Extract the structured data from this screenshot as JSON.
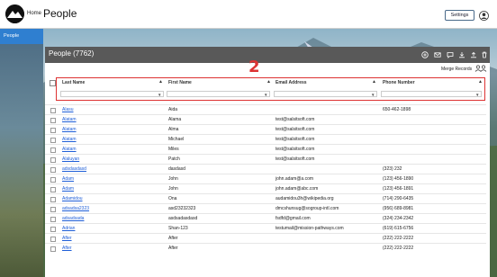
{
  "app": {
    "home_label": "Home",
    "title": "People",
    "settings_label": "Settings"
  },
  "sidebar": {
    "items": [
      {
        "label": "People"
      }
    ]
  },
  "panel": {
    "title": "People (7762)",
    "merge_label": "Merge Records",
    "annotation": "2"
  },
  "table": {
    "columns": [
      {
        "label": "Last Name"
      },
      {
        "label": "First Name"
      },
      {
        "label": "Email Address"
      },
      {
        "label": "Phone Number"
      }
    ],
    "rows": [
      {
        "last": "Alasu",
        "first": "Aida",
        "email": "",
        "phone": "650-462-1898"
      },
      {
        "last": "Alatam",
        "first": "Alama",
        "email": "test@salsitsoft.com",
        "phone": ""
      },
      {
        "last": "Alatam",
        "first": "Alma",
        "email": "test@salsitsoft.com",
        "phone": ""
      },
      {
        "last": "Alatam",
        "first": "Michael",
        "email": "test@salsitsoft.com",
        "phone": ""
      },
      {
        "last": "Alatam",
        "first": "Miles",
        "email": "test@salsitsoft.com",
        "phone": ""
      },
      {
        "last": "Alaluyan",
        "first": "Patch",
        "email": "test@salsitsoft.com",
        "phone": ""
      },
      {
        "last": "adsdasdasd",
        "first": "dasdasd",
        "email": "",
        "phone": "(323) 232"
      },
      {
        "last": "Adam",
        "first": "John",
        "email": "john.adam@a.com",
        "phone": "(123) 456-1890"
      },
      {
        "last": "Adam",
        "first": "John",
        "email": "john.adam@abc.com",
        "phone": "(123) 456-1891"
      },
      {
        "last": "Adamidou",
        "first": "Ona",
        "email": "audamidou3h@wikipedia.org",
        "phone": "(714) 290-6435"
      },
      {
        "last": "adsadsa2323",
        "first": "asd23232323",
        "email": "dmcshunsug@sogroup-intl.com",
        "phone": "(956) 689-8981"
      },
      {
        "last": "adsadsada",
        "first": "asdsadasdasd",
        "email": "fsdfd@gmail.com",
        "phone": "(324) 234-2342"
      },
      {
        "last": "Adrian",
        "first": "Shan-123",
        "email": "testumail@mission-pathways.com",
        "phone": "(619) 615-6756"
      },
      {
        "last": "After",
        "first": "After",
        "email": "",
        "phone": "(222) 222-2222"
      },
      {
        "last": "After",
        "first": "After",
        "email": "",
        "phone": "(222) 222-2222"
      }
    ]
  },
  "icons": {
    "header_icons": [
      "add-circle-icon",
      "mail-icon",
      "chat-icon",
      "download-icon",
      "upload-icon",
      "trash-icon"
    ]
  },
  "colors": {
    "accent": "#2f7fd0",
    "header_bg": "#595959",
    "link": "#1f5fd8",
    "annotation": "#dd3333"
  }
}
